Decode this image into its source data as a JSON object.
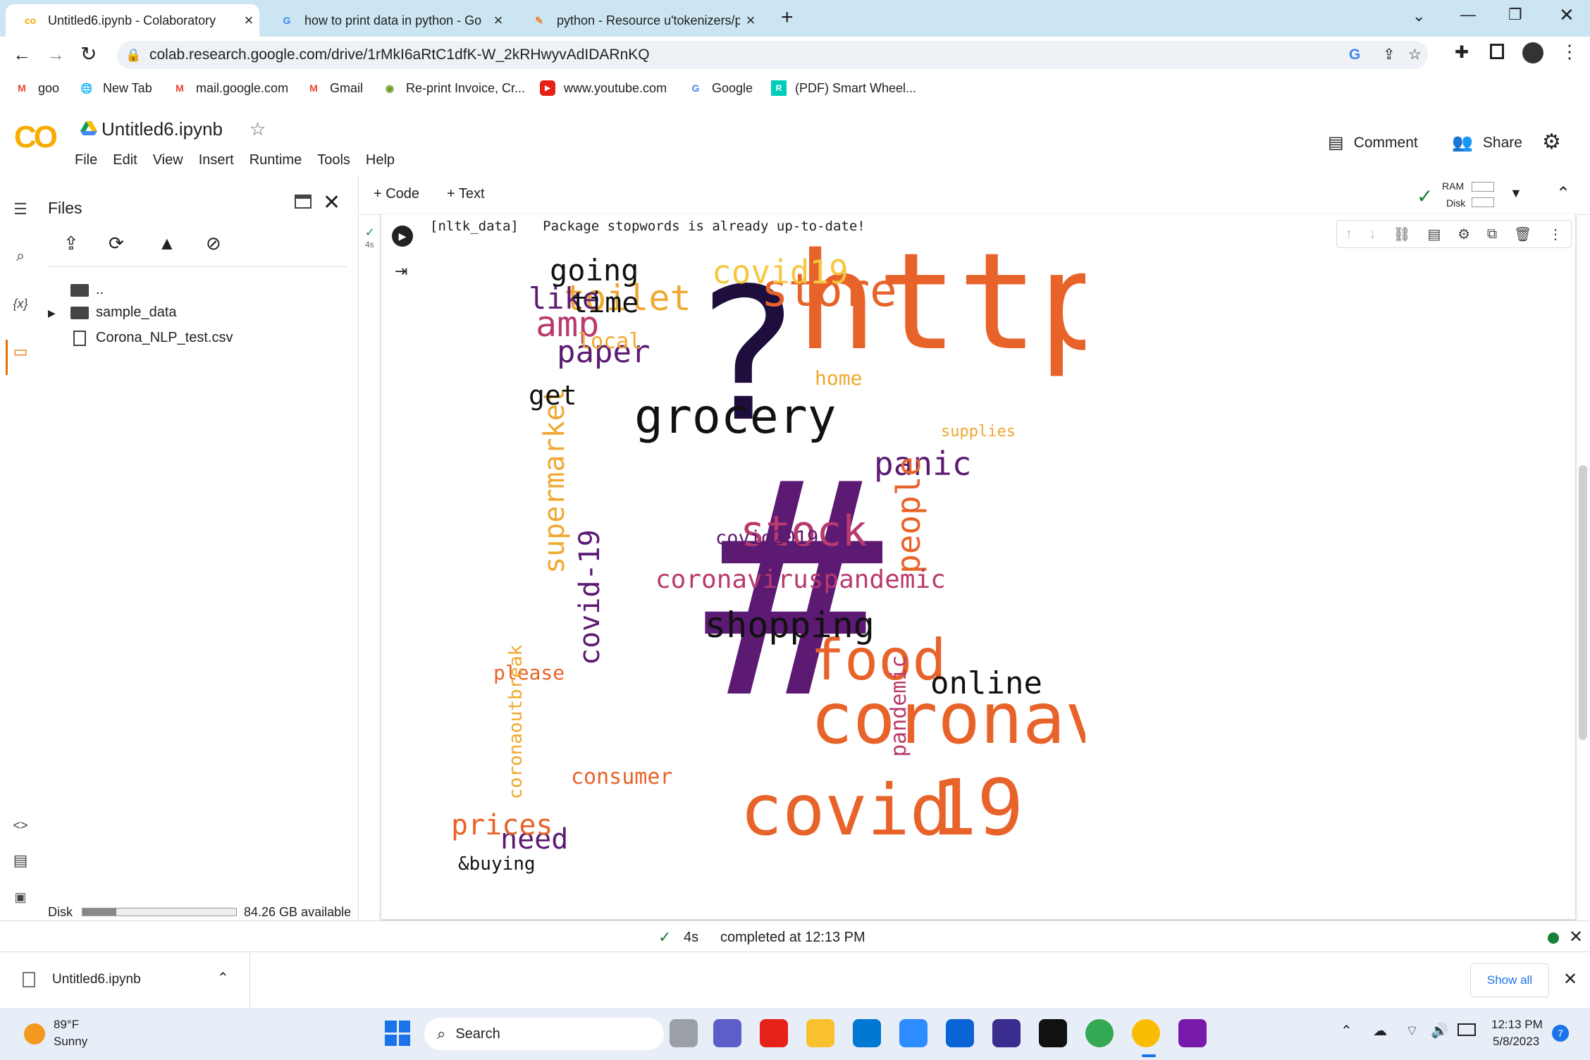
{
  "browser": {
    "tabs": [
      {
        "title": "Untitled6.ipynb - Colaboratory",
        "icon": "colab-icon"
      },
      {
        "title": "how to print data in python - Go",
        "icon": "google-icon"
      },
      {
        "title": "python - Resource u'tokenizers/p",
        "icon": "stackoverflow-icon"
      }
    ],
    "new_tab_label": "+",
    "url": "colab.research.google.com/drive/1rMkI6aRtC1dfK-W_2kRHwyvAdIDARnKQ",
    "bookmarks": [
      {
        "label": "goo",
        "icon": "gmail-icon"
      },
      {
        "label": "New Tab",
        "icon": "globe-icon"
      },
      {
        "label": "mail.google.com",
        "icon": "gmail-icon"
      },
      {
        "label": "Gmail",
        "icon": "gmail-icon"
      },
      {
        "label": "Re-print Invoice, Cr...",
        "icon": "invoice-icon"
      },
      {
        "label": "www.youtube.com",
        "icon": "youtube-icon"
      },
      {
        "label": "Google",
        "icon": "google-icon"
      },
      {
        "label": "(PDF) Smart Wheel...",
        "icon": "researchgate-icon"
      }
    ]
  },
  "colab": {
    "logo": "CO",
    "notebook_title": "Untitled6.ipynb",
    "menu": [
      "File",
      "Edit",
      "View",
      "Insert",
      "Runtime",
      "Tools",
      "Help"
    ],
    "comment_label": "Comment",
    "share_label": "Share",
    "add_code_label": "+ Code",
    "add_text_label": "+ Text",
    "ram_label": "RAM",
    "disk_label": "Disk"
  },
  "files_panel": {
    "title": "Files",
    "tree": [
      {
        "label": "..",
        "type": "parent"
      },
      {
        "label": "sample_data",
        "type": "folder"
      },
      {
        "label": "Corona_NLP_test.csv",
        "type": "file"
      }
    ],
    "disk_label": "Disk",
    "disk_available": "84.26 GB available",
    "disk_used_fraction": 0.22
  },
  "cell": {
    "exec_time": "4s",
    "output_line": "[nltk_data]   Package stopwords is already up-to-date!"
  },
  "status": {
    "duration": "4s",
    "message": "completed at 12:13 PM"
  },
  "download": {
    "filename": "Untitled6.ipynb",
    "show_all": "Show all"
  },
  "taskbar": {
    "temperature": "89°F",
    "weather": "Sunny",
    "search_label": "Search",
    "time": "12:13 PM",
    "date": "5/8/2023",
    "notifications": "7"
  },
  "wordcloud_words": [
    {
      "t": "https",
      "c": "#e8632a"
    },
    {
      "t": "#",
      "c": "#5c1a73"
    },
    {
      "t": "?",
      "c": "#1e0e3e"
    },
    {
      "t": "coronavirus",
      "c": "#e8632a"
    },
    {
      "t": "covid",
      "c": "#e8632a"
    },
    {
      "t": "19",
      "c": "#e8632a"
    },
    {
      "t": "store",
      "c": "#e8632a"
    },
    {
      "t": "grocery",
      "c": "#111111"
    },
    {
      "t": "food",
      "c": "#e8632a"
    },
    {
      "t": "stock",
      "c": "#b83a6e"
    },
    {
      "t": "shopping",
      "c": "#111111"
    },
    {
      "t": "online",
      "c": "#111111"
    },
    {
      "t": "supermarket",
      "c": "#f0a830"
    },
    {
      "t": "panic",
      "c": "#5c1a73"
    },
    {
      "t": "people",
      "c": "#e8632a"
    },
    {
      "t": "covid-19",
      "c": "#5c1a73"
    },
    {
      "t": "toilet",
      "c": "#f0a830"
    },
    {
      "t": "covid19",
      "c": "#f5c842"
    },
    {
      "t": "going",
      "c": "#111111"
    },
    {
      "t": "paper",
      "c": "#5c1a73"
    },
    {
      "t": "amp",
      "c": "#b83a6e"
    },
    {
      "t": "like",
      "c": "#5c1a73"
    },
    {
      "t": "time",
      "c": "#111111"
    },
    {
      "t": "get",
      "c": "#111111"
    },
    {
      "t": "need",
      "c": "#5c1a73"
    },
    {
      "t": "prices",
      "c": "#e8632a"
    },
    {
      "t": "&buying",
      "c": "#111111"
    },
    {
      "t": "coronaviruspandemic",
      "c": "#b83a6e"
    },
    {
      "t": "local",
      "c": "#f0a830"
    },
    {
      "t": "home",
      "c": "#f0a830"
    },
    {
      "t": "covid2019",
      "c": "#5c1a73"
    },
    {
      "t": "consumer",
      "c": "#e8632a"
    },
    {
      "t": "please",
      "c": "#e8632a"
    },
    {
      "t": "pandemic",
      "c": "#b83a6e"
    },
    {
      "t": "coronaoutbreak",
      "c": "#f0a830"
    },
    {
      "t": "supplies",
      "c": "#f0a830"
    }
  ]
}
